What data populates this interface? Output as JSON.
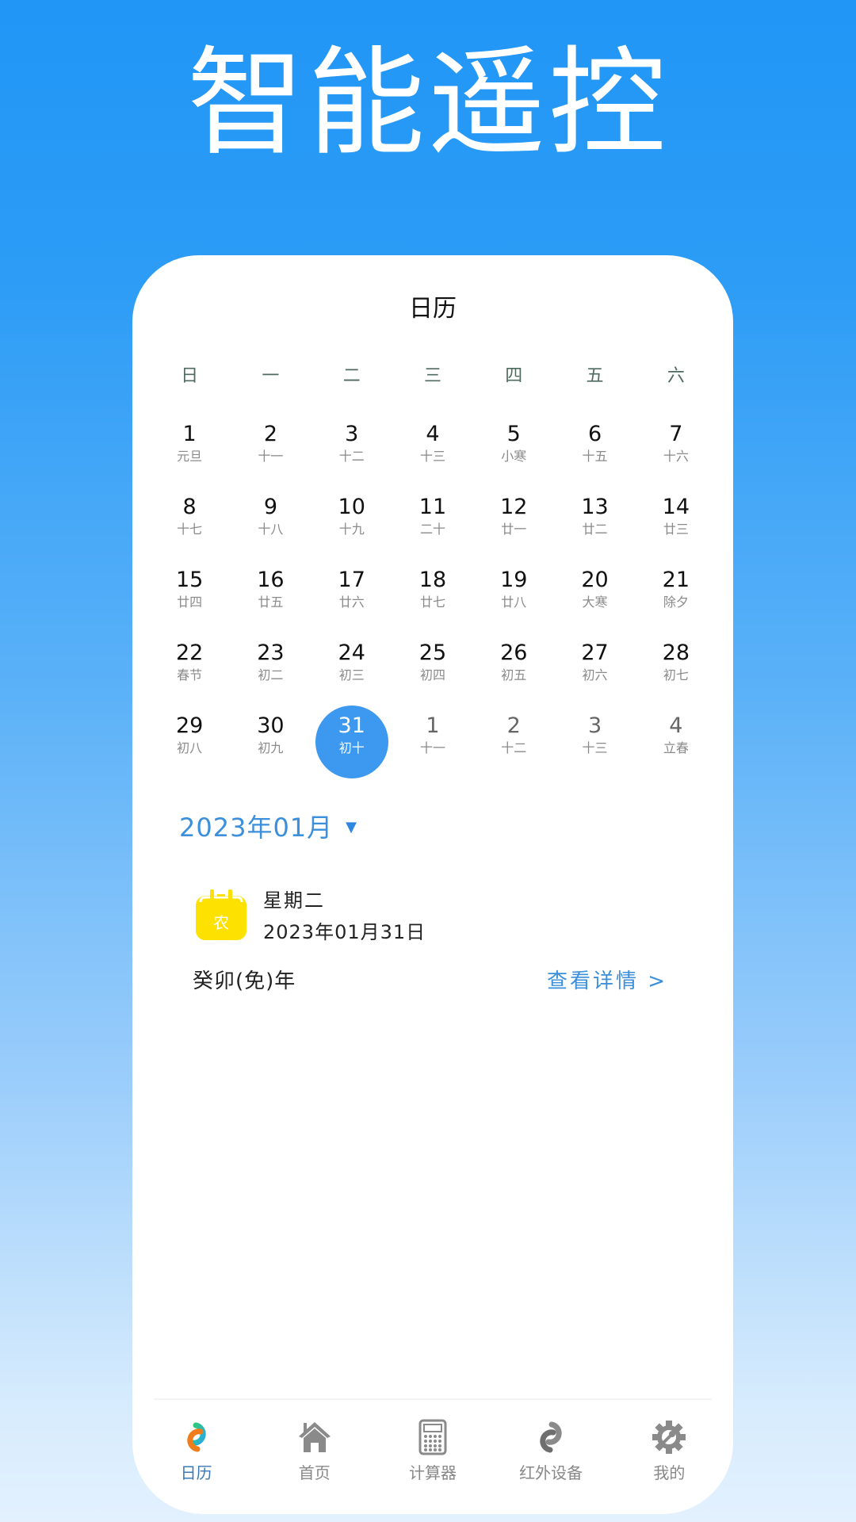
{
  "hero": {
    "title": "智能遥控"
  },
  "screen": {
    "title": "日历"
  },
  "calendar": {
    "weekdays": [
      "日",
      "一",
      "二",
      "三",
      "四",
      "五",
      "六"
    ],
    "weeks": [
      [
        {
          "day": "1",
          "lunar": "元旦"
        },
        {
          "day": "2",
          "lunar": "十一"
        },
        {
          "day": "3",
          "lunar": "十二"
        },
        {
          "day": "4",
          "lunar": "十三"
        },
        {
          "day": "5",
          "lunar": "小寒"
        },
        {
          "day": "6",
          "lunar": "十五"
        },
        {
          "day": "7",
          "lunar": "十六"
        }
      ],
      [
        {
          "day": "8",
          "lunar": "十七"
        },
        {
          "day": "9",
          "lunar": "十八"
        },
        {
          "day": "10",
          "lunar": "十九"
        },
        {
          "day": "11",
          "lunar": "二十"
        },
        {
          "day": "12",
          "lunar": "廿一"
        },
        {
          "day": "13",
          "lunar": "廿二"
        },
        {
          "day": "14",
          "lunar": "廿三"
        }
      ],
      [
        {
          "day": "15",
          "lunar": "廿四"
        },
        {
          "day": "16",
          "lunar": "廿五"
        },
        {
          "day": "17",
          "lunar": "廿六"
        },
        {
          "day": "18",
          "lunar": "廿七"
        },
        {
          "day": "19",
          "lunar": "廿八"
        },
        {
          "day": "20",
          "lunar": "大寒"
        },
        {
          "day": "21",
          "lunar": "除夕"
        }
      ],
      [
        {
          "day": "22",
          "lunar": "春节"
        },
        {
          "day": "23",
          "lunar": "初二"
        },
        {
          "day": "24",
          "lunar": "初三"
        },
        {
          "day": "25",
          "lunar": "初四"
        },
        {
          "day": "26",
          "lunar": "初五"
        },
        {
          "day": "27",
          "lunar": "初六"
        },
        {
          "day": "28",
          "lunar": "初七"
        }
      ],
      [
        {
          "day": "29",
          "lunar": "初八"
        },
        {
          "day": "30",
          "lunar": "初九"
        },
        {
          "day": "31",
          "lunar": "初十",
          "selected": true
        },
        {
          "day": "1",
          "lunar": "十一",
          "other_month": true
        },
        {
          "day": "2",
          "lunar": "十二",
          "other_month": true
        },
        {
          "day": "3",
          "lunar": "十三",
          "other_month": true
        },
        {
          "day": "4",
          "lunar": "立春",
          "other_month": true
        }
      ]
    ],
    "month_label": "2023年01月",
    "month_caret": "▼"
  },
  "selected_info": {
    "icon": "lunar-calendar-icon",
    "icon_glyph": "农",
    "weekday": "星期二",
    "date": "2023年01月31日",
    "ganzhi_year": "癸卯(免)年",
    "details_link": "查看详情 >"
  },
  "bottom_nav": [
    {
      "label": "日历",
      "icon": "calendar-rings-icon",
      "active": true
    },
    {
      "label": "首页",
      "icon": "home-icon",
      "active": false
    },
    {
      "label": "计算器",
      "icon": "calculator-icon",
      "active": false
    },
    {
      "label": "红外设备",
      "icon": "link-icon",
      "active": false
    },
    {
      "label": "我的",
      "icon": "settings-gear-icon",
      "active": false
    }
  ],
  "colors": {
    "accent": "#3d98ef",
    "link": "#3b8fdb",
    "icon_yellow": "#fde100",
    "nav_active": "#3a78b8"
  }
}
